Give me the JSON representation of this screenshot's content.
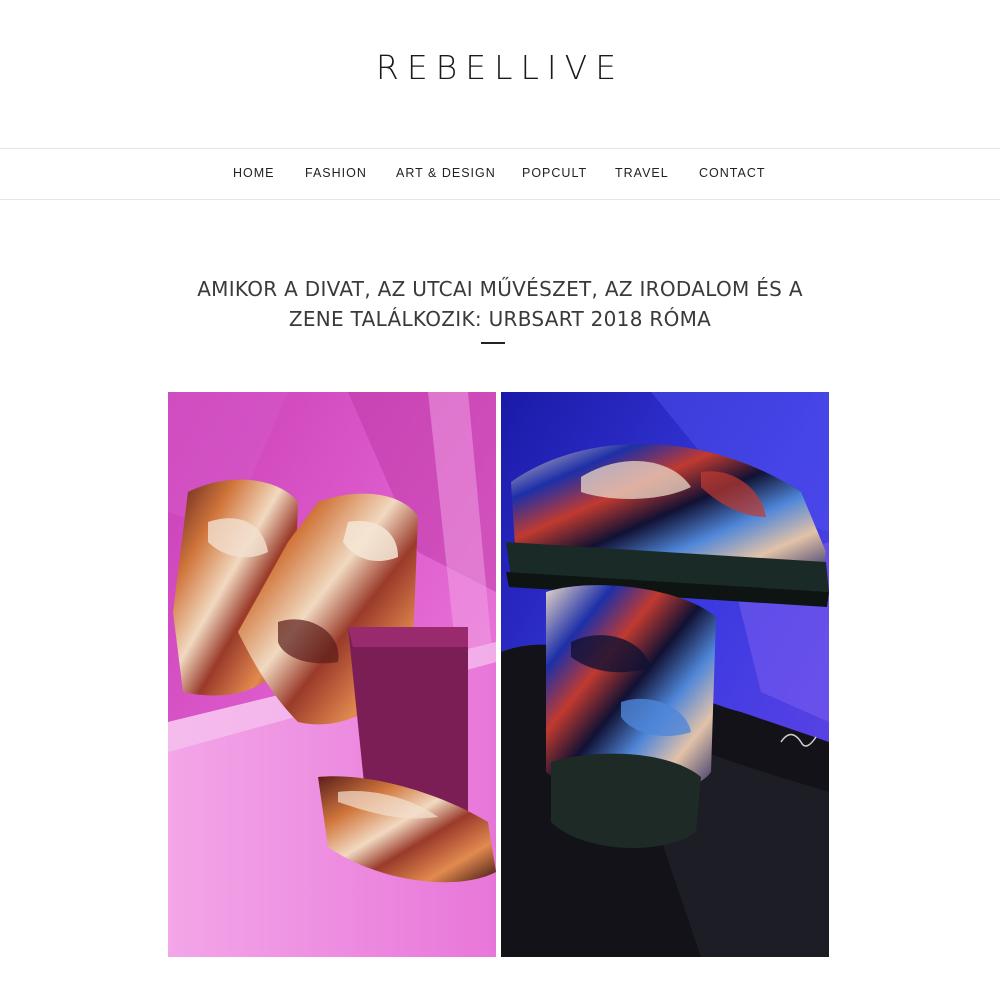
{
  "site": {
    "title": "REBELLIVE"
  },
  "nav": {
    "items": [
      {
        "label": "HOME"
      },
      {
        "label": "FASHION"
      },
      {
        "label": "ART & DESIGN"
      },
      {
        "label": "POPCULT"
      },
      {
        "label": "TRAVEL"
      },
      {
        "label": "CONTACT"
      }
    ]
  },
  "post": {
    "title_line1": "AMIKOR A DIVAT, AZ UTCAI MŰVÉSZET, AZ IRODALOM ÉS A",
    "title_line2": "ZENE TALÁLKOZIK: URBSART 2018 RÓMA"
  },
  "gallery": {
    "images": [
      {
        "subject": "marbled-boots-on-pink-background"
      },
      {
        "subject": "marbled-sandals-on-blue-fabric"
      }
    ]
  },
  "colors": {
    "background": "#ffffff",
    "text": "#222222",
    "divider": "#e6e6e6",
    "pink_backdrop": "#d94fc4",
    "blue_backdrop": "#2a2ad6"
  }
}
